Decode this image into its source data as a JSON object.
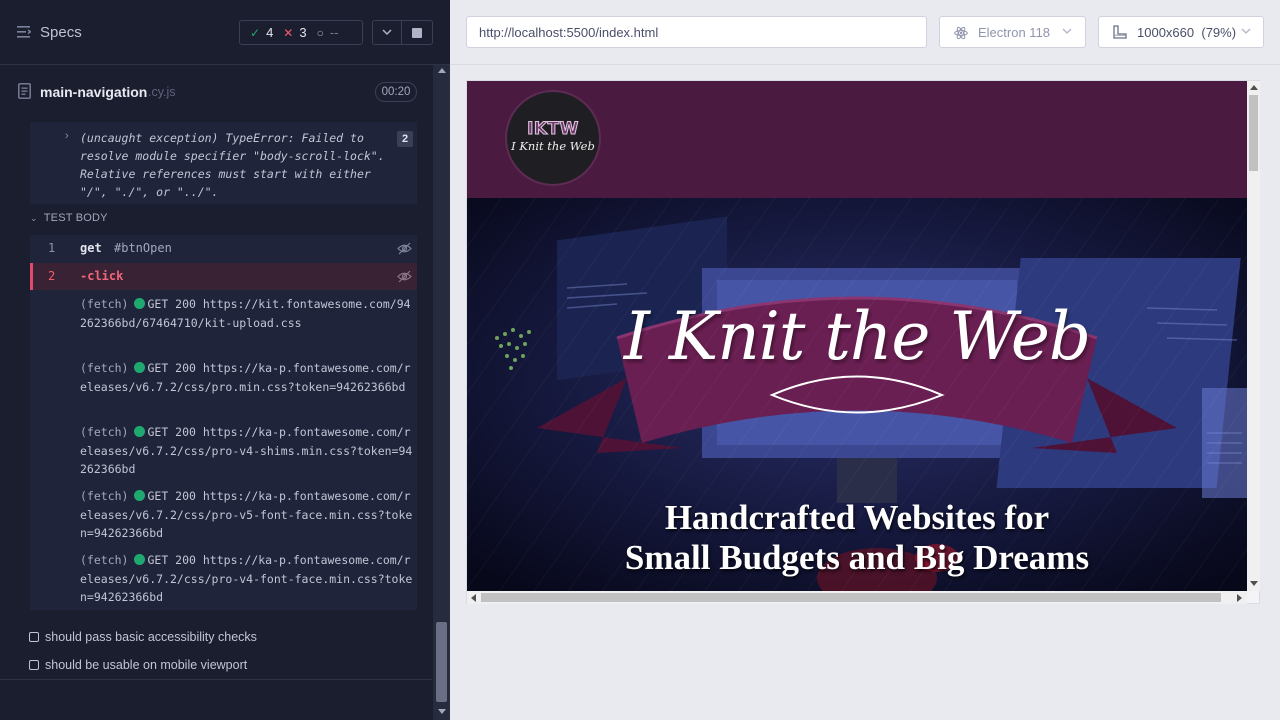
{
  "runner": {
    "specs_label": "Specs",
    "stats": {
      "passed": "4",
      "failed": "3",
      "pending": "--"
    },
    "spec": {
      "name": "main-navigation",
      "ext": ".cy.js",
      "duration": "00:20"
    },
    "uncaught": {
      "text": "(uncaught exception)  TypeError: Failed to resolve module specifier \"body-scroll-lock\". Relative references must start with either \"/\", \"./\", or \"../\".",
      "count": "2"
    },
    "test_body_label": "TEST BODY",
    "commands": [
      {
        "num": "1",
        "name": "get",
        "arg": "#btnOpen"
      },
      {
        "num": "2",
        "name": "-click",
        "arg": ""
      }
    ],
    "fetches": [
      {
        "label": "(fetch)",
        "method": "GET 200",
        "url": "https://kit.fontawesome.com/94262366bd/67464710/kit-upload.css"
      },
      {
        "label": "(fetch)",
        "method": "GET 200",
        "url": "https://ka-p.fontawesome.com/releases/v6.7.2/css/pro.min.css?token=94262366bd"
      },
      {
        "label": "(fetch)",
        "method": "GET 200",
        "url": "https://ka-p.fontawesome.com/releases/v6.7.2/css/pro-v4-shims.min.css?token=94262366bd"
      },
      {
        "label": "(fetch)",
        "method": "GET 200",
        "url": "https://ka-p.fontawesome.com/releases/v6.7.2/css/pro-v5-font-face.min.css?token=94262366bd"
      },
      {
        "label": "(fetch)",
        "method": "GET 200",
        "url": "https://ka-p.fontawesome.com/releases/v6.7.2/css/pro-v4-font-face.min.css?token=94262366bd"
      }
    ],
    "tests": [
      "should pass basic accessibility checks",
      "should be usable on mobile viewport"
    ]
  },
  "aut": {
    "url": "http://localhost:5500/index.html",
    "browser": "Electron 118",
    "viewport": "1000x660",
    "scale": "(79%)",
    "site": {
      "logo_top": "IKTW",
      "logo_bottom": "I Knit the Web",
      "hero_title": "I Knit the Web",
      "tagline_line1": "Handcrafted Websites for",
      "tagline_line2": "Small Budgets and Big Dreams"
    }
  },
  "colors": {
    "runner_bg": "#1b1e2e",
    "pass": "#1fa971",
    "fail": "#f25b6d",
    "site_header": "#4b1a40",
    "ribbon": "#6a1f52"
  },
  "icons": [
    "menu-icon",
    "check-icon",
    "x-icon",
    "spinner-icon",
    "chevron-down-icon",
    "stop-icon",
    "file-icon",
    "eye-slash-icon",
    "electron-icon",
    "ruler-icon"
  ]
}
